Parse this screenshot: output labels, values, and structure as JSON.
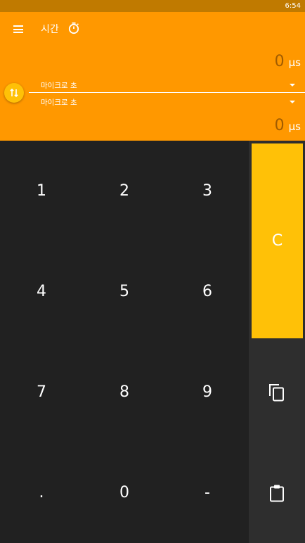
{
  "status_bar": {
    "time": "6:54"
  },
  "toolbar": {
    "title": "시간"
  },
  "converter": {
    "from": {
      "value": "0",
      "unit_symbol": "μs",
      "unit_name": "마이크로 초"
    },
    "to": {
      "value": "0",
      "unit_symbol": "μs",
      "unit_name": "마이크로 초"
    }
  },
  "keypad": {
    "keys": [
      "1",
      "2",
      "3",
      "4",
      "5",
      "6",
      "7",
      "8",
      "9",
      ".",
      "0",
      "-"
    ]
  },
  "actions": {
    "clear_label": "C",
    "copy_icon": "copy-icon",
    "paste_icon": "clipboard-paste-icon"
  },
  "colors": {
    "primary": "#ff9800",
    "primary_dark": "#c07a00",
    "accent": "#ffc107",
    "keypad_bg": "#212121",
    "side_bg": "#2e2e2e"
  }
}
